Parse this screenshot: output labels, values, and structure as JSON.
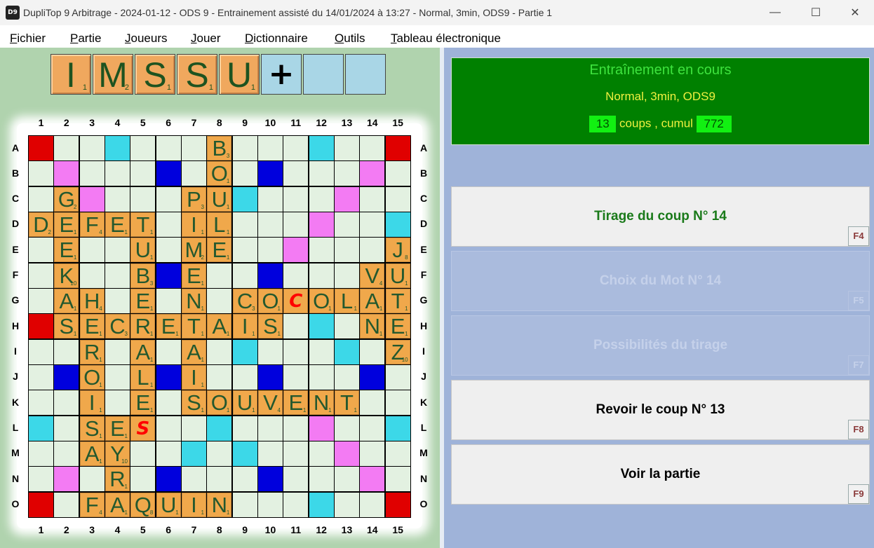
{
  "window": {
    "icon_text": "D9",
    "title": "DupliTop 9 Arbitrage - 2024-01-12 - ODS 9 - Entrainement assisté du 14/01/2024 à 13:27 - Normal, 3min, ODS9 - Partie 1",
    "minimize": "—",
    "maximize": "☐",
    "close": "✕"
  },
  "menu": [
    {
      "first": "F",
      "rest": "ichier"
    },
    {
      "first": "P",
      "rest": "artie"
    },
    {
      "first": "J",
      "rest": "oueurs"
    },
    {
      "first": "J",
      "rest": "ouer"
    },
    {
      "first": "D",
      "rest": "ictionnaire"
    },
    {
      "first": "O",
      "rest": "utils"
    },
    {
      "first": "T",
      "rest": "ableau électronique"
    }
  ],
  "rack": [
    {
      "letter": "I",
      "value": "1"
    },
    {
      "letter": "M",
      "value": "2"
    },
    {
      "letter": "S",
      "value": "1"
    },
    {
      "letter": "S",
      "value": "1"
    },
    {
      "letter": "U",
      "value": "1"
    },
    {
      "letter": "+",
      "value": ""
    },
    {
      "letter": "",
      "value": ""
    },
    {
      "letter": "",
      "value": ""
    }
  ],
  "board": {
    "col_labels": [
      "1",
      "2",
      "3",
      "4",
      "5",
      "6",
      "7",
      "8",
      "9",
      "10",
      "11",
      "12",
      "13",
      "14",
      "15"
    ],
    "row_labels": [
      "A",
      "B",
      "C",
      "D",
      "E",
      "F",
      "G",
      "H",
      "I",
      "J",
      "K",
      "L",
      "M",
      "N",
      "O"
    ],
    "square_colors": {
      "normal": "#e3f1e1",
      "double_letter": "#3cd8e8",
      "triple_letter": "#0000dd",
      "double_word": "#f37bf3",
      "triple_word": "#e00000"
    },
    "premium_rows": [
      "T......T.....T.",
      ".W...t.....t...W.",
      "..W.......W..",
      "...W......W...",
      "....W.....W....",
      ".....t...t.....",
      "...............",
      "T..............",
      "...............",
      "...............",
      "...............",
      "...............",
      "...............",
      "...............",
      "..............."
    ],
    "grid": [
      "T..d...B...d..T",
      ".W...t.O.t...W.",
      "dGW...PUd...W..",
      "DEFET.IL...W..d",
      ".E..U.ME..W...J",
      ".K..BtE..t...VU",
      ".AH.E.N.CO*OLAT",
      "TSECRETAIS.d.NE",
      "..R.A.Ad...d..Z",
      ".tO.Lti..t...t.",
      "..I.E.SOUVENT..",
      "d.SE*..d...W..d",
      "..AY..d.d...W..",
      ".W.R.t...t...W.",
      "T.FAQUI.N...d.T"
    ],
    "values": [
      "...............",
      "...............",
      ".2....31.......",
      "21411.11.......",
      ".1..1.21......8",
      ".10.3.1......41",
      ".14.1.1.31.1111",
      ".1131111.11..11",
      "..1.1.1.......10",
      "..1.1.1........",
      "..1.1.111141.1.",
      "..11...........",
      "..110..........",
      "...1...........",
      "..41812.1......"
    ],
    "tiles": [
      {
        "r": 0,
        "c": 7,
        "letter": "B",
        "value": "3"
      },
      {
        "r": 1,
        "c": 7,
        "letter": "O",
        "value": "1"
      },
      {
        "r": 2,
        "c": 1,
        "letter": "G",
        "value": "2"
      },
      {
        "r": 2,
        "c": 6,
        "letter": "P",
        "value": "3"
      },
      {
        "r": 2,
        "c": 7,
        "letter": "U",
        "value": "1"
      },
      {
        "r": 3,
        "c": 0,
        "letter": "D",
        "value": "2"
      },
      {
        "r": 3,
        "c": 1,
        "letter": "E",
        "value": "1"
      },
      {
        "r": 3,
        "c": 2,
        "letter": "F",
        "value": "4"
      },
      {
        "r": 3,
        "c": 3,
        "letter": "E",
        "value": "1"
      },
      {
        "r": 3,
        "c": 4,
        "letter": "T",
        "value": "1"
      },
      {
        "r": 3,
        "c": 6,
        "letter": "I",
        "value": "1"
      },
      {
        "r": 3,
        "c": 7,
        "letter": "L",
        "value": "1"
      },
      {
        "r": 4,
        "c": 1,
        "letter": "E",
        "value": "1"
      },
      {
        "r": 4,
        "c": 4,
        "letter": "U",
        "value": "1"
      },
      {
        "r": 4,
        "c": 6,
        "letter": "M",
        "value": "2"
      },
      {
        "r": 4,
        "c": 7,
        "letter": "E",
        "value": "1"
      },
      {
        "r": 4,
        "c": 14,
        "letter": "J",
        "value": "8"
      },
      {
        "r": 5,
        "c": 1,
        "letter": "K",
        "value": "10"
      },
      {
        "r": 5,
        "c": 4,
        "letter": "B",
        "value": "3"
      },
      {
        "r": 5,
        "c": 6,
        "letter": "E",
        "value": "1"
      },
      {
        "r": 5,
        "c": 13,
        "letter": "V",
        "value": "4"
      },
      {
        "r": 5,
        "c": 14,
        "letter": "U",
        "value": "1"
      },
      {
        "r": 6,
        "c": 1,
        "letter": "A",
        "value": "1"
      },
      {
        "r": 6,
        "c": 2,
        "letter": "H",
        "value": "4"
      },
      {
        "r": 6,
        "c": 4,
        "letter": "E",
        "value": "1"
      },
      {
        "r": 6,
        "c": 6,
        "letter": "N",
        "value": "1"
      },
      {
        "r": 6,
        "c": 8,
        "letter": "C",
        "value": "3"
      },
      {
        "r": 6,
        "c": 9,
        "letter": "O",
        "value": "1"
      },
      {
        "r": 6,
        "c": 10,
        "letter": "C",
        "value": "",
        "joker": true
      },
      {
        "r": 6,
        "c": 11,
        "letter": "O",
        "value": "1"
      },
      {
        "r": 6,
        "c": 12,
        "letter": "L",
        "value": "1"
      },
      {
        "r": 6,
        "c": 13,
        "letter": "A",
        "value": "1"
      },
      {
        "r": 6,
        "c": 14,
        "letter": "T",
        "value": "1"
      },
      {
        "r": 7,
        "c": 1,
        "letter": "S",
        "value": "1"
      },
      {
        "r": 7,
        "c": 2,
        "letter": "E",
        "value": "1"
      },
      {
        "r": 7,
        "c": 3,
        "letter": "C",
        "value": "3"
      },
      {
        "r": 7,
        "c": 4,
        "letter": "R",
        "value": "1"
      },
      {
        "r": 7,
        "c": 5,
        "letter": "E",
        "value": "1"
      },
      {
        "r": 7,
        "c": 6,
        "letter": "T",
        "value": "1"
      },
      {
        "r": 7,
        "c": 7,
        "letter": "A",
        "value": "1"
      },
      {
        "r": 7,
        "c": 8,
        "letter": "I",
        "value": "1"
      },
      {
        "r": 7,
        "c": 9,
        "letter": "S",
        "value": "1"
      },
      {
        "r": 7,
        "c": 13,
        "letter": "N",
        "value": "1"
      },
      {
        "r": 7,
        "c": 14,
        "letter": "E",
        "value": "1"
      },
      {
        "r": 8,
        "c": 2,
        "letter": "R",
        "value": "1"
      },
      {
        "r": 8,
        "c": 4,
        "letter": "A",
        "value": "1"
      },
      {
        "r": 8,
        "c": 6,
        "letter": "A",
        "value": "1"
      },
      {
        "r": 8,
        "c": 14,
        "letter": "Z",
        "value": "10"
      },
      {
        "r": 9,
        "c": 2,
        "letter": "O",
        "value": "1"
      },
      {
        "r": 9,
        "c": 4,
        "letter": "L",
        "value": "1"
      },
      {
        "r": 9,
        "c": 6,
        "letter": "I",
        "value": "1"
      },
      {
        "r": 10,
        "c": 2,
        "letter": "I",
        "value": "1"
      },
      {
        "r": 10,
        "c": 4,
        "letter": "E",
        "value": "1"
      },
      {
        "r": 10,
        "c": 6,
        "letter": "S",
        "value": "1"
      },
      {
        "r": 10,
        "c": 7,
        "letter": "O",
        "value": "1"
      },
      {
        "r": 10,
        "c": 8,
        "letter": "U",
        "value": "1"
      },
      {
        "r": 10,
        "c": 9,
        "letter": "V",
        "value": "4"
      },
      {
        "r": 10,
        "c": 10,
        "letter": "E",
        "value": "1"
      },
      {
        "r": 10,
        "c": 11,
        "letter": "N",
        "value": "1"
      },
      {
        "r": 10,
        "c": 12,
        "letter": "T",
        "value": "1"
      },
      {
        "r": 11,
        "c": 2,
        "letter": "S",
        "value": "1"
      },
      {
        "r": 11,
        "c": 3,
        "letter": "E",
        "value": "1"
      },
      {
        "r": 11,
        "c": 4,
        "letter": "S",
        "value": "",
        "joker": true
      },
      {
        "r": 12,
        "c": 2,
        "letter": "A",
        "value": "1"
      },
      {
        "r": 12,
        "c": 3,
        "letter": "Y",
        "value": "10"
      },
      {
        "r": 13,
        "c": 3,
        "letter": "R",
        "value": "1"
      },
      {
        "r": 14,
        "c": 2,
        "letter": "F",
        "value": "4"
      },
      {
        "r": 14,
        "c": 3,
        "letter": "A",
        "value": "1"
      },
      {
        "r": 14,
        "c": 4,
        "letter": "Q",
        "value": "8"
      },
      {
        "r": 14,
        "c": 5,
        "letter": "U",
        "value": "1"
      },
      {
        "r": 14,
        "c": 6,
        "letter": "I",
        "value": "1"
      },
      {
        "r": 14,
        "c": 7,
        "letter": "N",
        "value": "1"
      }
    ],
    "premiums": {
      "triple_word": [
        [
          0,
          0
        ],
        [
          0,
          14
        ],
        [
          7,
          0
        ],
        [
          14,
          0
        ],
        [
          14,
          14
        ]
      ],
      "double_word": [
        [
          1,
          1
        ],
        [
          1,
          13
        ],
        [
          2,
          2
        ],
        [
          2,
          12
        ],
        [
          3,
          11
        ],
        [
          4,
          10
        ],
        [
          11,
          11
        ],
        [
          12,
          12
        ],
        [
          13,
          1
        ],
        [
          13,
          13
        ]
      ],
      "triple_letter": [
        [
          1,
          5
        ],
        [
          1,
          9
        ],
        [
          5,
          5
        ],
        [
          5,
          9
        ],
        [
          9,
          1
        ],
        [
          9,
          5
        ],
        [
          9,
          9
        ],
        [
          9,
          13
        ],
        [
          13,
          5
        ],
        [
          13,
          9
        ]
      ],
      "double_letter": [
        [
          0,
          3
        ],
        [
          0,
          11
        ],
        [
          2,
          8
        ],
        [
          3,
          14
        ],
        [
          7,
          11
        ],
        [
          8,
          8
        ],
        [
          8,
          12
        ],
        [
          11,
          0
        ],
        [
          11,
          7
        ],
        [
          11,
          14
        ],
        [
          12,
          6
        ],
        [
          12,
          8
        ],
        [
          14,
          11
        ]
      ]
    }
  },
  "status": {
    "title": "Entraînement en cours",
    "mode": "Normal, 3min, ODS9",
    "coups": "13",
    "coups_label": "coups , cumul",
    "cumul": "772"
  },
  "buttons": [
    {
      "label": "Tirage du coup N° 14",
      "key": "F4",
      "enabled": true,
      "color": "#1a7a1a"
    },
    {
      "label": "Choix du Mot N° 14",
      "key": "F5",
      "enabled": false,
      "color": "#c5d1ea"
    },
    {
      "label": "Possibilités du tirage",
      "key": "F7",
      "enabled": false,
      "color": "#c5d1ea"
    },
    {
      "label": "Revoir le coup N° 13",
      "key": "F8",
      "enabled": true,
      "color": "#000000"
    },
    {
      "label": "Voir la partie",
      "key": "F9",
      "enabled": true,
      "color": "#000000"
    }
  ]
}
